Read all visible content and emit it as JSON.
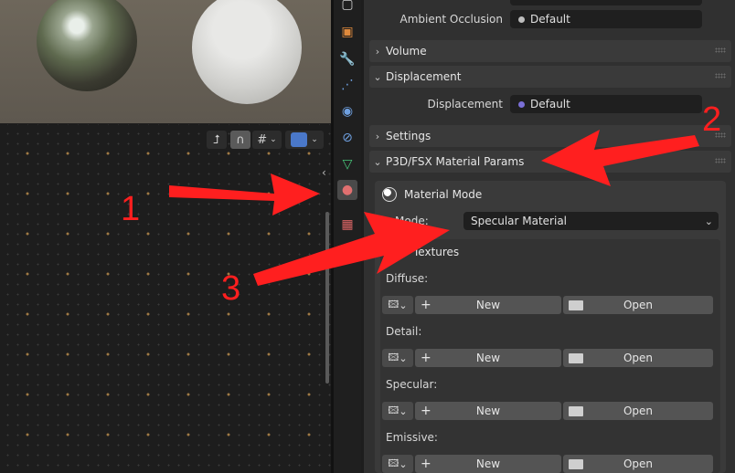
{
  "properties": {
    "ambient_occlusion": {
      "label": "Ambient Occlusion",
      "value": "Default"
    },
    "sections": {
      "volume": "Volume",
      "displacement": "Displacement",
      "settings": "Settings",
      "p3d": "P3D/FSX Material Params"
    },
    "displacement_field": {
      "label": "Displacement",
      "value": "Default"
    },
    "material_mode": {
      "title": "Material Mode",
      "select_label": "Mode:",
      "select_value": "Specular Material"
    },
    "textures": {
      "title": "Textures",
      "slots": [
        {
          "label": "Diffuse:",
          "new": "New",
          "open": "Open"
        },
        {
          "label": "Detail:",
          "new": "New",
          "open": "Open"
        },
        {
          "label": "Specular:",
          "new": "New",
          "open": "Open"
        },
        {
          "label": "Emissive:",
          "new": "New",
          "open": "Open"
        }
      ]
    }
  },
  "annotations": [
    "1",
    "2",
    "3"
  ],
  "icons": {
    "tabs": [
      "object-icon",
      "modifier-icon",
      "particles-icon",
      "physics-icon",
      "constraints-icon",
      "data-icon",
      "material-icon",
      "texture-icon"
    ]
  },
  "colors": {
    "annotation": "#ff1f1f",
    "panel": "#303030",
    "field": "#1f1f1f"
  }
}
